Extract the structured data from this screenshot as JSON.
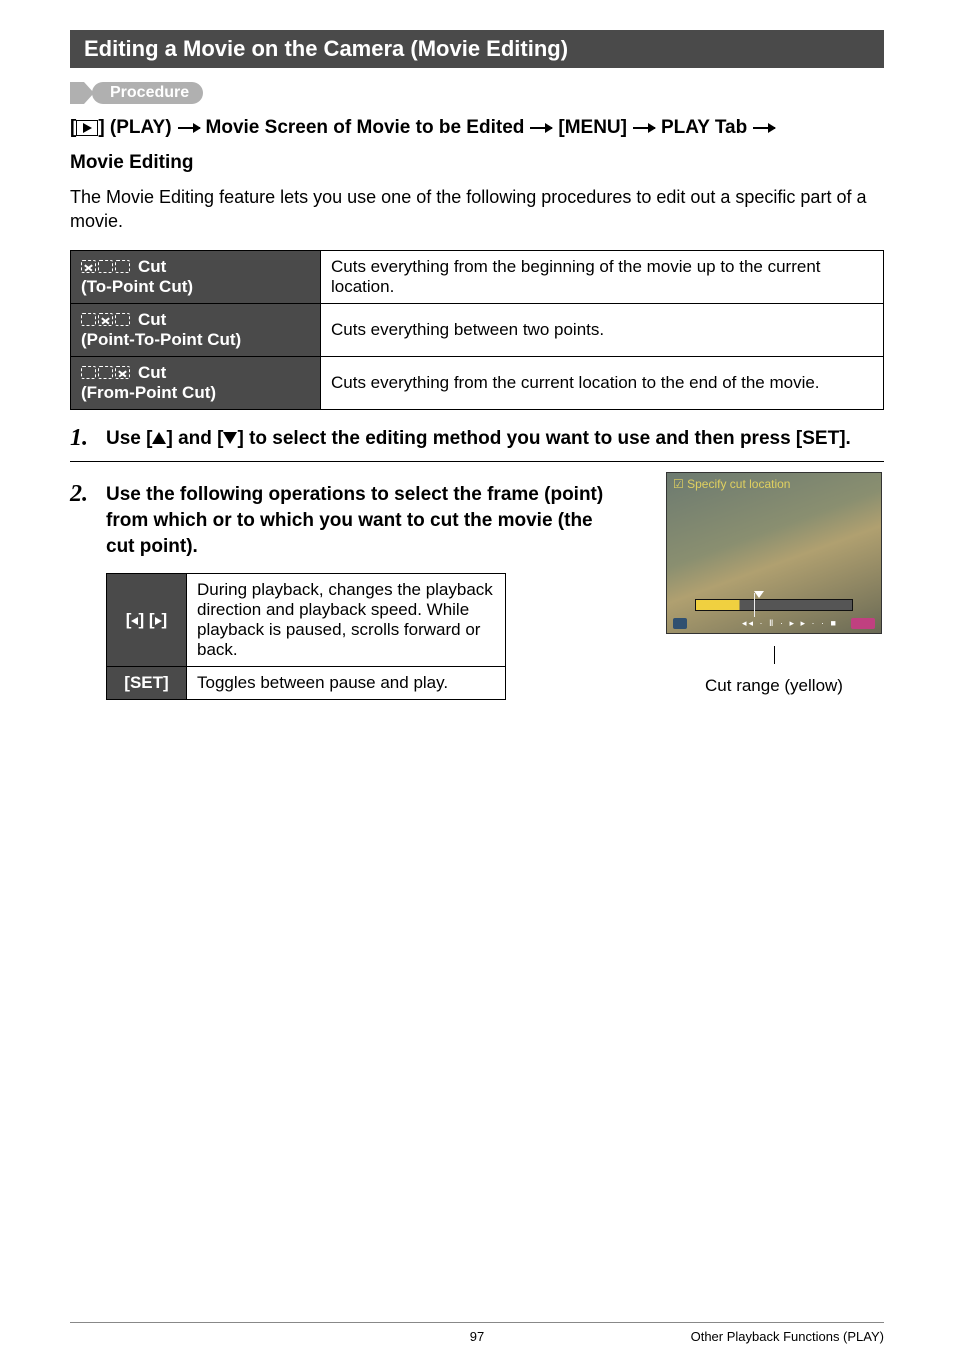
{
  "title": "Editing a Movie on the Camera (Movie Editing)",
  "procedure_label": "Procedure",
  "path": {
    "p1_prefix": "[",
    "p1_suffix": "] (PLAY)",
    "p2": "Movie Screen of Movie to be Edited",
    "p3": "[MENU]",
    "p4": "PLAY Tab",
    "p5": "Movie Editing"
  },
  "intro": "The Movie Editing feature lets you use one of the following procedures to edit out a specific part of a movie.",
  "cut_rows": [
    {
      "label": "Cut",
      "sub": "(To-Point Cut)",
      "desc": "Cuts everything from the beginning of the movie up to the current location.",
      "pattern": [
        "x",
        "p",
        "p"
      ]
    },
    {
      "label": "Cut",
      "sub": "(Point-To-Point Cut)",
      "desc": "Cuts everything between two points.",
      "pattern": [
        "p",
        "x",
        "p"
      ]
    },
    {
      "label": "Cut",
      "sub": "(From-Point Cut)",
      "desc": "Cuts everything from the current location to the end of the movie.",
      "pattern": [
        "p",
        "p",
        "x"
      ]
    }
  ],
  "steps": {
    "s1_pre": "Use [",
    "s1_mid": "] and [",
    "s1_post": "] to select the editing method you want to use and then press [SET].",
    "s2": "Use the following operations to select the frame (point) from which or to which you want to cut the movie (the cut point)."
  },
  "controls": [
    {
      "key_left": true,
      "key_right": true,
      "key_text": "",
      "desc": "During playback, changes the playback direction and playback speed. While playback is paused, scrolls forward or back."
    },
    {
      "key_text": "[SET]",
      "desc": "Toggles between pause and play."
    }
  ],
  "thumb": {
    "title": "Specify cut location",
    "caption": "Cut range (yellow)"
  },
  "footer": {
    "page": "97",
    "section": "Other Playback Functions (PLAY)"
  }
}
